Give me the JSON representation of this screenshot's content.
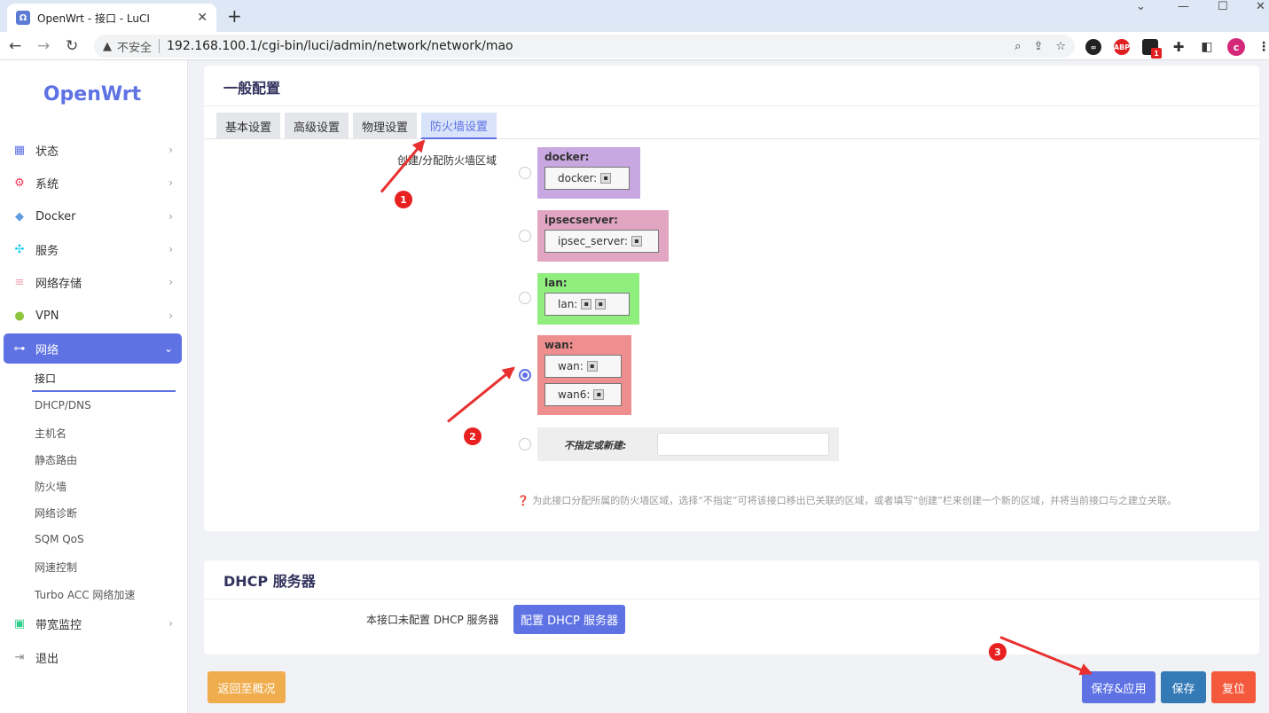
{
  "browser": {
    "tab_title": "OpenWrt - 接口 - LuCI",
    "insecure_label": "不安全",
    "url": "192.168.100.1/cgi-bin/luci/admin/network/network/mao",
    "profile_initial": "c",
    "ext_badge": "1"
  },
  "sidebar": {
    "logo": "OpenWrt",
    "items": [
      {
        "label": "状态",
        "icon": "dashboard-icon",
        "color": "#5e72e4"
      },
      {
        "label": "系统",
        "icon": "gear-icon",
        "color": "#f5365c"
      },
      {
        "label": "Docker",
        "icon": "docker-icon",
        "color": "#5e9ce4"
      },
      {
        "label": "服务",
        "icon": "services-icon",
        "color": "#11cdef"
      },
      {
        "label": "网络存储",
        "icon": "database-icon",
        "color": "#f3a4b5"
      },
      {
        "label": "VPN",
        "icon": "vpn-icon",
        "color": "#8dc63f"
      },
      {
        "label": "网络",
        "icon": "network-icon",
        "color": "#ffffff"
      },
      {
        "label": "带宽监控",
        "icon": "monitor-icon",
        "color": "#2dce89"
      },
      {
        "label": "退出",
        "icon": "logout-icon",
        "color": "#888888"
      }
    ],
    "submenu": [
      "接口",
      "DHCP/DNS",
      "主机名",
      "静态路由",
      "防火墙",
      "网络诊断",
      "SQM QoS",
      "网速控制",
      "Turbo ACC 网络加速"
    ]
  },
  "general": {
    "title": "一般配置",
    "tabs": [
      "基本设置",
      "高级设置",
      "物理设置",
      "防火墙设置"
    ],
    "field_label": "创建/分配防火墙区域",
    "zones": [
      {
        "name": "docker:",
        "color": "#c9a7e0",
        "interfaces": [
          "docker:"
        ]
      },
      {
        "name": "ipsecserver:",
        "color": "#e2a6c3",
        "interfaces": [
          "ipsec_server:"
        ]
      },
      {
        "name": "lan:",
        "color": "#90ee7e",
        "interfaces": [
          "lan:"
        ]
      },
      {
        "name": "wan:",
        "color": "#ef8e8e",
        "interfaces": [
          "wan:",
          "wan6:"
        ]
      }
    ],
    "unspecified_label": "不指定或新建:",
    "hint": "为此接口分配所属的防火墙区域，选择“不指定”可将该接口移出已关联的区域，或者填写“创建”栏来创建一个新的区域，并将当前接口与之建立关联。"
  },
  "dhcp": {
    "title": "DHCP 服务器",
    "label": "本接口未配置 DHCP 服务器",
    "button": "配置 DHCP 服务器"
  },
  "footer": {
    "back": "返回至概况",
    "save_apply": "保存&应用",
    "save": "保存",
    "reset": "复位"
  },
  "annotations": [
    "1",
    "2",
    "3"
  ]
}
